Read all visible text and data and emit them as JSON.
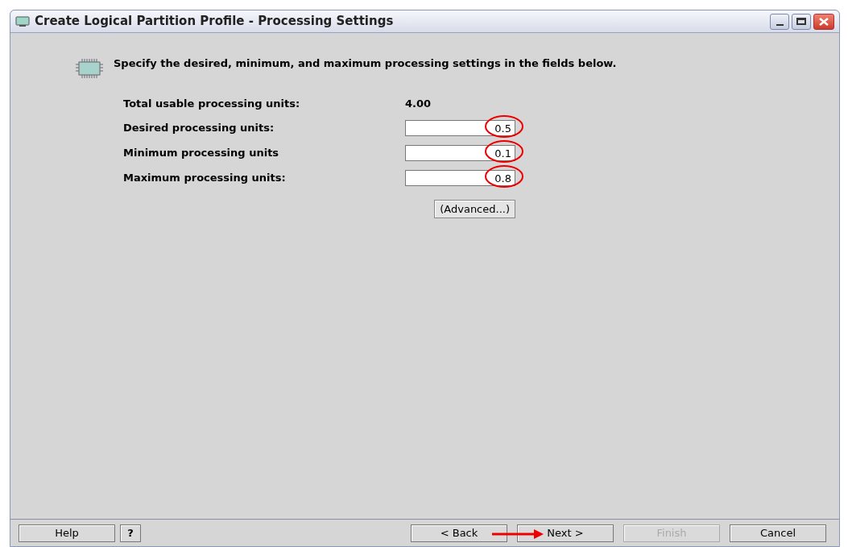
{
  "window": {
    "title": "Create Logical Partition Profile - Processing Settings"
  },
  "instruction": "Specify the desired, minimum, and maximum processing settings in the fields below.",
  "total": {
    "label": "Total usable processing units:",
    "value": "4.00"
  },
  "fields": [
    {
      "label": "Desired processing units:",
      "value": "0.5",
      "highlighted": true
    },
    {
      "label": "Minimum processing units",
      "value": "0.1",
      "highlighted": true
    },
    {
      "label": "Maximum processing units:",
      "value": "0.8",
      "highlighted": true
    }
  ],
  "advanced_button": "(Advanced...)",
  "buttons": [
    {
      "label": "Help",
      "disabled": false,
      "kind": "left"
    },
    {
      "label": "?",
      "disabled": false,
      "kind": "left"
    },
    {
      "label": "< Back",
      "disabled": false,
      "kind": "right"
    },
    {
      "label": "Next >",
      "disabled": false,
      "kind": "right"
    },
    {
      "label": "Finish",
      "disabled": true,
      "kind": "right"
    },
    {
      "label": "Cancel",
      "disabled": false,
      "kind": "right"
    }
  ]
}
